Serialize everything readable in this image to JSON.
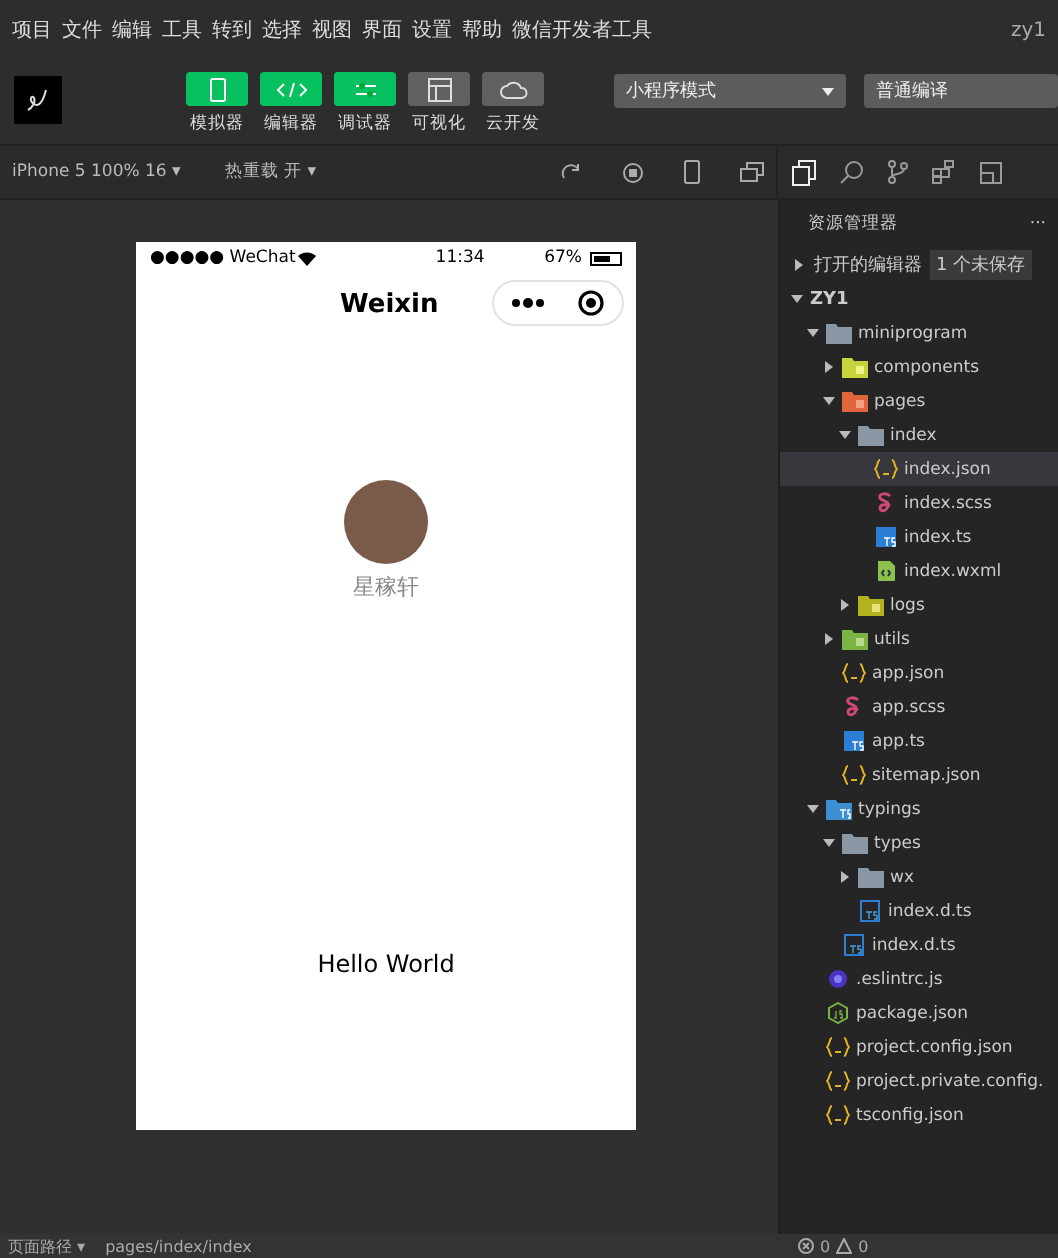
{
  "menu": [
    "项目",
    "文件",
    "编辑",
    "工具",
    "转到",
    "选择",
    "视图",
    "界面",
    "设置",
    "帮助",
    "微信开发者工具"
  ],
  "user": "zy1",
  "toolbar": {
    "buttons": [
      {
        "label": "模拟器",
        "kind": "phone",
        "on": true
      },
      {
        "label": "编辑器",
        "kind": "code",
        "on": true
      },
      {
        "label": "调试器",
        "kind": "debug",
        "on": true
      },
      {
        "label": "可视化",
        "kind": "layout",
        "on": false
      },
      {
        "label": "云开发",
        "kind": "cloud",
        "on": false
      }
    ],
    "mode": "小程序模式",
    "compile": "普通编译"
  },
  "simulator_bar": {
    "device": "iPhone 5 100% 16 ▾",
    "hot_reload": "热重载 开 ▾"
  },
  "phone": {
    "carrier": "●●●●● WeChat",
    "time": "11:34",
    "battery": "67%",
    "title": "Weixin",
    "nickname": "星稼轩",
    "body_text": "Hello World"
  },
  "explorer": {
    "title": "资源管理器",
    "more": "···",
    "open_editors": "打开的编辑器",
    "unsaved": "1 个未保存",
    "tree": [
      {
        "name": "ZY1",
        "kind": "root",
        "expanded": true,
        "selected": false,
        "children": [
          {
            "name": "miniprogram",
            "kind": "folder",
            "expanded": true,
            "selected": false,
            "children": [
              {
                "name": "components",
                "kind": "components-folder",
                "expanded": false,
                "selected": false
              },
              {
                "name": "pages",
                "kind": "pages-folder",
                "expanded": true,
                "selected": false,
                "children": [
                  {
                    "name": "index",
                    "kind": "folder",
                    "expanded": true,
                    "selected": false,
                    "children": [
                      {
                        "name": "index.json",
                        "kind": "json",
                        "selected": true
                      },
                      {
                        "name": "index.scss",
                        "kind": "scss",
                        "selected": false
                      },
                      {
                        "name": "index.ts",
                        "kind": "ts",
                        "selected": false
                      },
                      {
                        "name": "index.wxml",
                        "kind": "wxml",
                        "selected": false
                      }
                    ]
                  },
                  {
                    "name": "logs",
                    "kind": "logs-folder",
                    "expanded": false,
                    "selected": false
                  }
                ]
              },
              {
                "name": "utils",
                "kind": "utils-folder",
                "expanded": false,
                "selected": false
              },
              {
                "name": "app.json",
                "kind": "json",
                "selected": false
              },
              {
                "name": "app.scss",
                "kind": "scss",
                "selected": false
              },
              {
                "name": "app.ts",
                "kind": "ts",
                "selected": false
              },
              {
                "name": "sitemap.json",
                "kind": "json",
                "selected": false
              }
            ]
          },
          {
            "name": "typings",
            "kind": "ts-folder",
            "expanded": true,
            "selected": false,
            "children": [
              {
                "name": "types",
                "kind": "folder",
                "expanded": true,
                "selected": false,
                "children": [
                  {
                    "name": "wx",
                    "kind": "folder",
                    "expanded": false,
                    "selected": false
                  },
                  {
                    "name": "index.d.ts",
                    "kind": "dts",
                    "selected": false
                  }
                ]
              },
              {
                "name": "index.d.ts",
                "kind": "dts",
                "selected": false
              }
            ]
          },
          {
            "name": ".eslintrc.js",
            "kind": "eslint",
            "selected": false
          },
          {
            "name": "package.json",
            "kind": "package",
            "selected": false
          },
          {
            "name": "project.config.json",
            "kind": "json",
            "selected": false
          },
          {
            "name": "project.private.config.",
            "kind": "json",
            "selected": false
          },
          {
            "name": "tsconfig.json",
            "kind": "json",
            "selected": false
          }
        ]
      }
    ]
  },
  "status_bar": {
    "page_path": "页面路径 ▾",
    "path": "pages/index/index",
    "errors": "0",
    "warnings": "0"
  }
}
